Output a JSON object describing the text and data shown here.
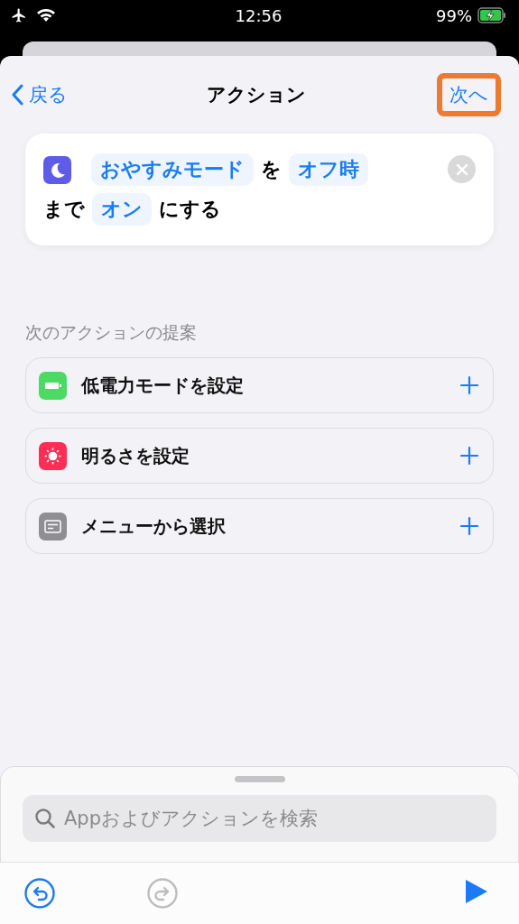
{
  "status_bar": {
    "time": "12:56",
    "battery": "99%",
    "airplane_mode": true,
    "charging": true
  },
  "nav": {
    "back": "戻る",
    "title": "アクション",
    "next": {
      "label": "次へ",
      "highlighted": true
    }
  },
  "action": {
    "tokens": [
      {
        "kind": "param",
        "text": "おやすみモード"
      },
      {
        "kind": "text",
        "text": "を"
      },
      {
        "kind": "param",
        "text": "オフ時"
      },
      {
        "kind": "text",
        "text": "まで"
      },
      {
        "kind": "param",
        "text": "オン"
      },
      {
        "kind": "text",
        "text": "にする"
      }
    ]
  },
  "suggestions": {
    "header": "次のアクションの提案",
    "items": [
      {
        "kind": "battery",
        "label": "低電力モードを設定",
        "color": "#4cd964"
      },
      {
        "kind": "brightness",
        "label": "明るさを設定",
        "color": "#ff2d55"
      },
      {
        "kind": "menu",
        "label": "メニューから選択",
        "color": "#8e8e93"
      }
    ]
  },
  "search": {
    "placeholder": "Appおよびアクションを検索"
  },
  "toolbar": {
    "undo_disabled": false,
    "redo_disabled": true
  }
}
